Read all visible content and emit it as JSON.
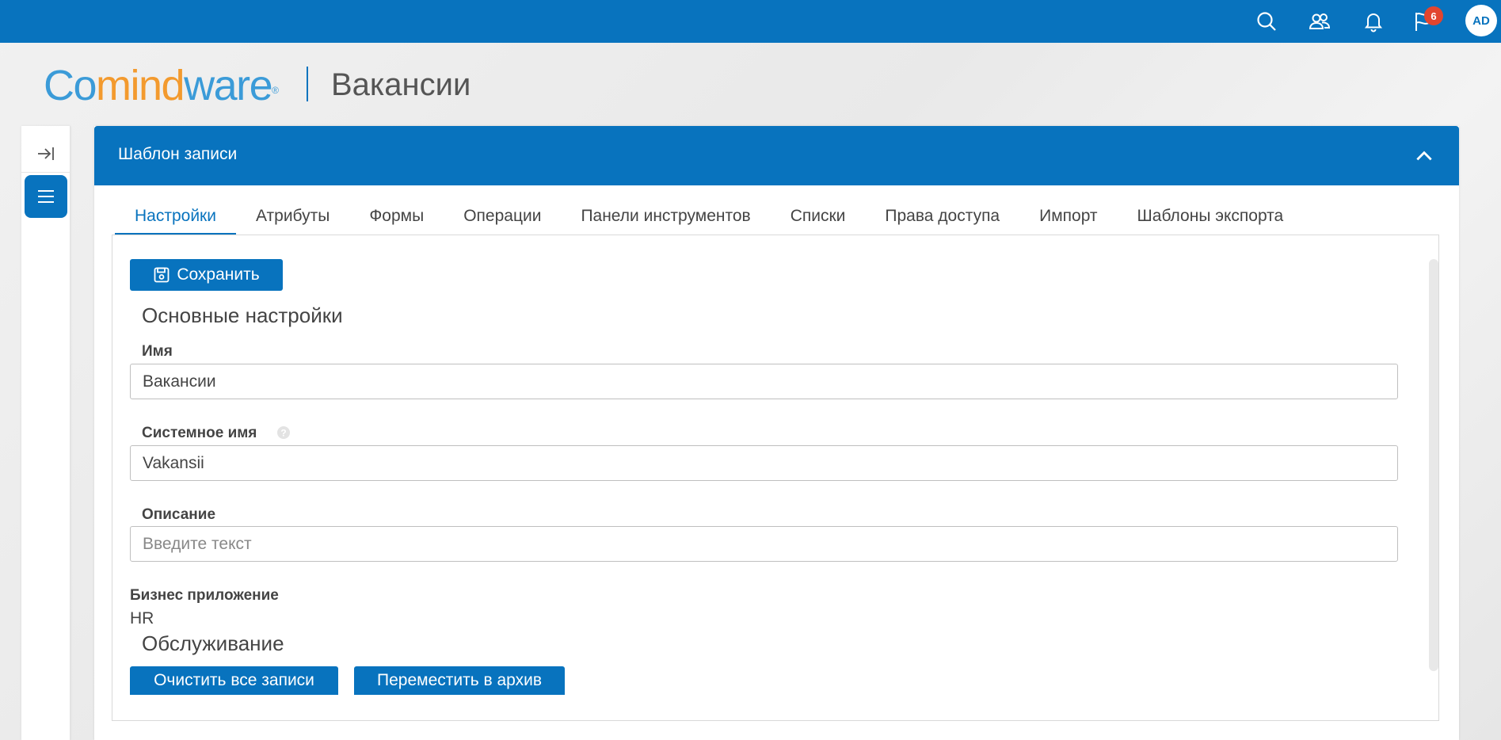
{
  "topbar": {
    "icons": [
      "search-icon",
      "users-icon",
      "bell-icon",
      "flag-icon"
    ],
    "notification_count": "6",
    "user_initials": "AD"
  },
  "brand": {
    "logo_part1": "Co",
    "logo_part2": "mind",
    "logo_part3": "ware",
    "logo_reg": "®",
    "page_title": "Вакансии"
  },
  "panel": {
    "header_title": "Шаблон записи",
    "tabs": [
      {
        "label": "Настройки",
        "active": true
      },
      {
        "label": "Атрибуты",
        "active": false
      },
      {
        "label": "Формы",
        "active": false
      },
      {
        "label": "Операции",
        "active": false
      },
      {
        "label": "Панели инструментов",
        "active": false
      },
      {
        "label": "Списки",
        "active": false
      },
      {
        "label": "Права доступа",
        "active": false
      },
      {
        "label": "Импорт",
        "active": false
      },
      {
        "label": "Шаблоны экспорта",
        "active": false
      }
    ]
  },
  "form": {
    "save_label": "Сохранить",
    "main_section_title": "Основные настройки",
    "name_label": "Имя",
    "name_value": "Вакансии",
    "system_name_label": "Системное имя",
    "system_name_value": "Vakansii",
    "description_label": "Описание",
    "description_placeholder": "Введите текст",
    "business_app_label": "Бизнес приложение",
    "business_app_value": "HR",
    "maintenance_section_title": "Обслуживание",
    "clear_all_label": "Очистить все записи",
    "archive_label": "Переместить в архив"
  },
  "colors": {
    "primary": "#0873be",
    "logo_blue": "#3b9bd8",
    "logo_orange": "#f39a2e",
    "badge": "#e2452f"
  }
}
